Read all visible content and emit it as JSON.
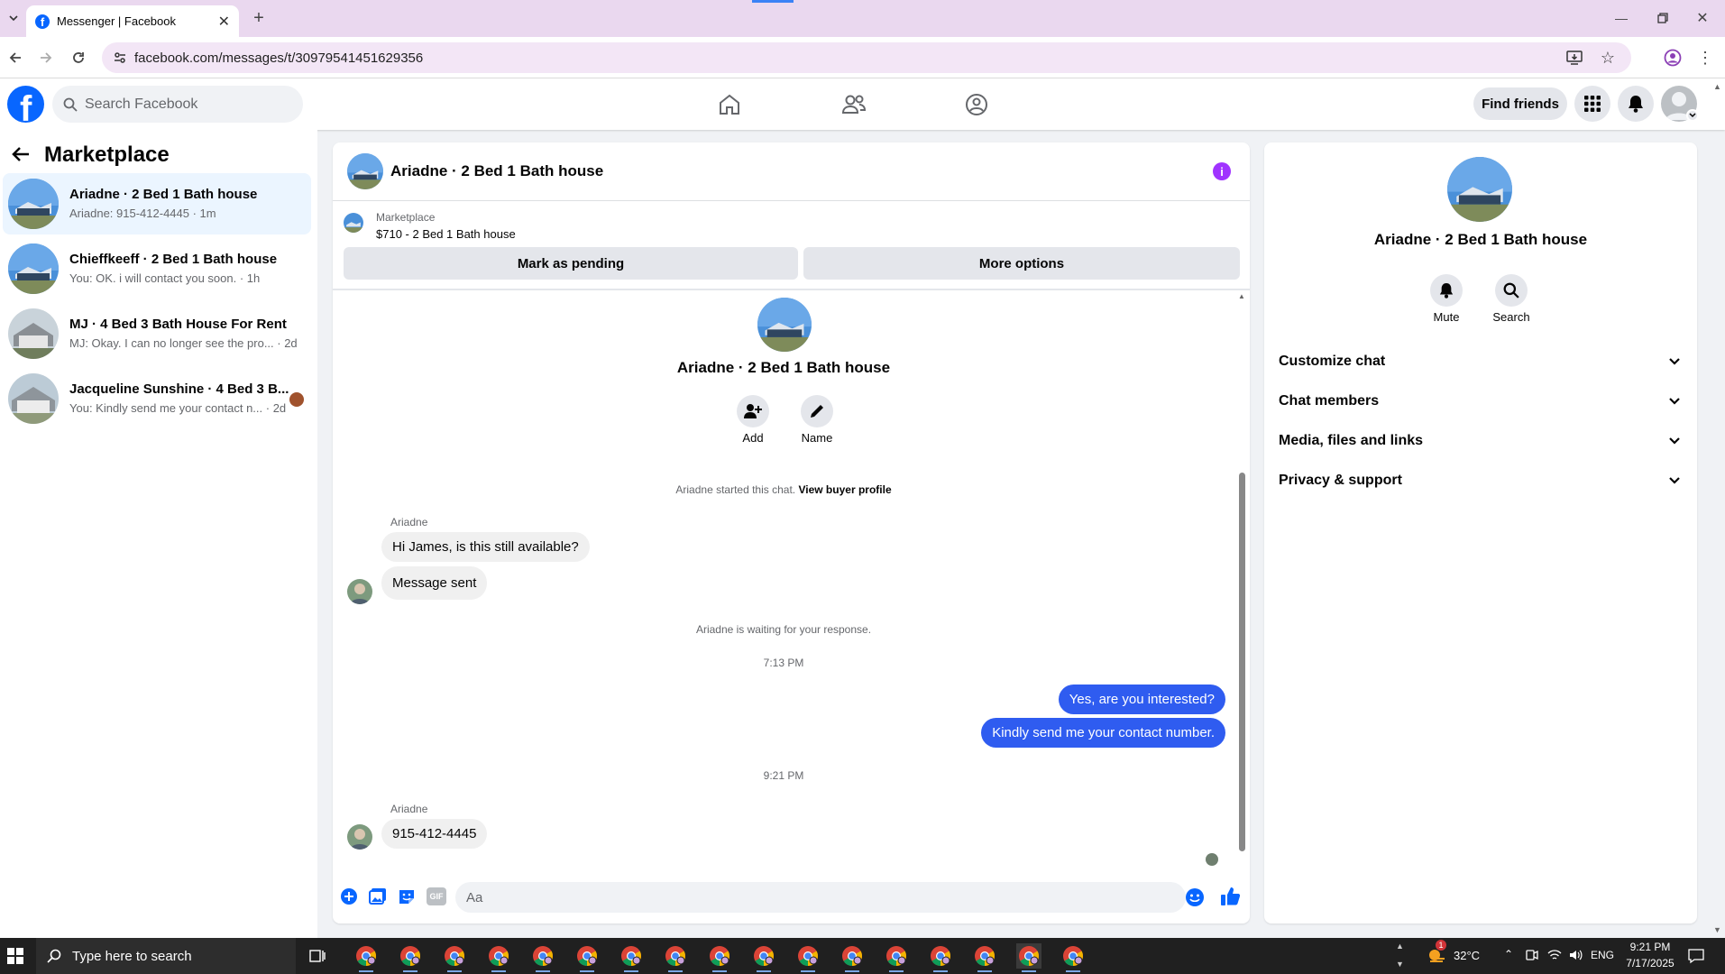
{
  "browser": {
    "tab_title": "Messenger | Facebook",
    "url": "facebook.com/messages/t/30979541451629356"
  },
  "fb": {
    "search_placeholder": "Search Facebook",
    "find_friends": "Find friends"
  },
  "left": {
    "title": "Marketplace",
    "conversations": [
      {
        "title": "Ariadne · 2 Bed 1 Bath house",
        "snippet": "Ariadne: 915-412-4445 · 1m"
      },
      {
        "title": "Chieffkeeff · 2 Bed 1 Bath house",
        "snippet": "You: OK. i will contact you soon. · 1h"
      },
      {
        "title": "MJ · 4 Bed 3 Bath House For Rent",
        "snippet": "MJ: Okay. I can no longer see the pro... · 2d"
      },
      {
        "title": "Jacqueline Sunshine · 4 Bed 3 B...",
        "snippet": "You: Kindly send me your contact n... · 2d"
      }
    ]
  },
  "chat": {
    "header_title": "Ariadne · 2 Bed 1 Bath house",
    "listing_label": "Marketplace",
    "listing_price": "$710 - 2 Bed 1 Bath house",
    "mark_pending": "Mark as pending",
    "more_options": "More options",
    "intro_title": "Ariadne · 2 Bed 1 Bath house",
    "add_label": "Add",
    "name_label": "Name",
    "started_text": "Ariadne started this chat.",
    "view_profile": "View buyer profile",
    "sender1": "Ariadne",
    "msg1": "Hi James, is this still available?",
    "msg2": "Message sent",
    "waiting": "Ariadne is waiting for your response.",
    "time1": "7:13 PM",
    "out1": "Yes, are you interested?",
    "out2": "Kindly send me your contact number.",
    "time2": "9:21 PM",
    "sender2": "Ariadne",
    "msg3": "915-412-4445",
    "composer_placeholder": "Aa"
  },
  "right": {
    "title": "Ariadne · 2 Bed 1 Bath house",
    "mute": "Mute",
    "search": "Search",
    "sections": [
      "Customize chat",
      "Chat members",
      "Media, files and links",
      "Privacy & support"
    ]
  },
  "taskbar": {
    "search_placeholder": "Type here to search",
    "temp": "32°C",
    "lang": "ENG",
    "time": "9:21 PM",
    "date": "7/17/2025",
    "badge": "1"
  },
  "colors": {
    "accent": "#2f5cf0",
    "fb_blue": "#0866ff",
    "info_purple": "#a033ff"
  }
}
